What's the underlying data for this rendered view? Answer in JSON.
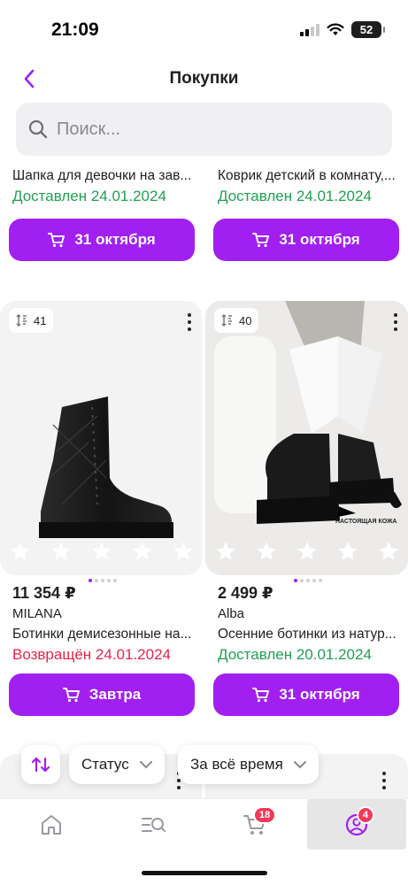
{
  "status_bar": {
    "time": "21:09",
    "battery": "52"
  },
  "header": {
    "title": "Покупки"
  },
  "search": {
    "placeholder": "Поиск..."
  },
  "top_cards": [
    {
      "title": "Шапка для девочки на зав...",
      "status": "Доставлен 24.01.2024",
      "status_color": "#20a052",
      "button": "31 октября"
    },
    {
      "title": "Коврик детский в комнату,...",
      "status": "Доставлен 24.01.2024",
      "status_color": "#20a052",
      "button": "31 октября"
    }
  ],
  "products": [
    {
      "size": "41",
      "rating_stars": 0,
      "price": "11 354 ₽",
      "brand": "MILANA",
      "title": "Ботинки демисезонные на...",
      "status": "Возвращён 24.01.2024",
      "status_color": "#e5254b",
      "button": "Завтра"
    },
    {
      "size": "40",
      "rating_stars": 0,
      "price": "2 499 ₽",
      "brand": "Alba",
      "title": "Осенние ботинки из натур...",
      "status": "Доставлен 20.01.2024",
      "status_color": "#20a052",
      "button": "31 октября",
      "leather_label": "НАСТОЯЩАЯ КОЖА"
    }
  ],
  "filters": {
    "status": "Статус",
    "period": "За всё время"
  },
  "nav": {
    "cart_badge": "18",
    "profile_badge": "4"
  },
  "colors": {
    "accent": "#a21ff2",
    "green": "#20a052",
    "red": "#e5254b"
  }
}
